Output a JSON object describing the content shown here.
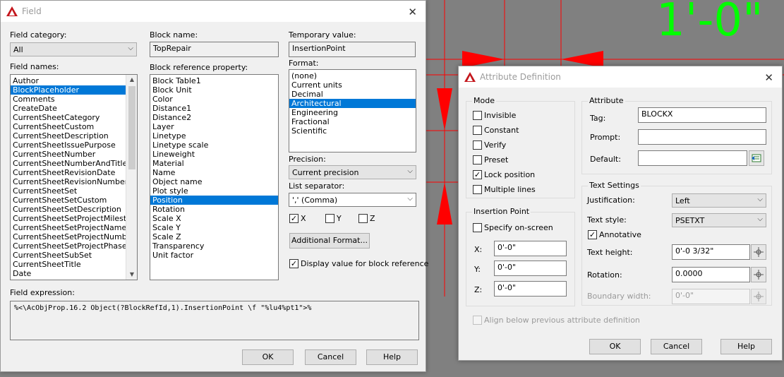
{
  "colors": {
    "dimension_line": "#ff0000",
    "dimension_text": "#00ff00",
    "selection": "#0078d7",
    "canvas": "#808080"
  },
  "canvas": {
    "dimension_text": "1'-0\""
  },
  "field_dialog": {
    "title": "Field",
    "field_category_label": "Field category:",
    "field_category_value": "All",
    "field_names_label": "Field names:",
    "field_names": [
      "Author",
      "BlockPlaceholder",
      "Comments",
      "CreateDate",
      "CurrentSheetCategory",
      "CurrentSheetCustom",
      "CurrentSheetDescription",
      "CurrentSheetIssuePurpose",
      "CurrentSheetNumber",
      "CurrentSheetNumberAndTitle",
      "CurrentSheetRevisionDate",
      "CurrentSheetRevisionNumber",
      "CurrentSheetSet",
      "CurrentSheetSetCustom",
      "CurrentSheetSetDescription",
      "CurrentSheetSetProjectMilestone",
      "CurrentSheetSetProjectName",
      "CurrentSheetSetProjectNumber",
      "CurrentSheetSetProjectPhase",
      "CurrentSheetSubSet",
      "CurrentSheetTitle",
      "Date"
    ],
    "field_names_selected": "BlockPlaceholder",
    "block_name_label": "Block name:",
    "block_name_value": "TopRepair",
    "block_ref_label": "Block reference property:",
    "block_ref_properties": [
      "Block Table1",
      "Block Unit",
      "Color",
      "Distance1",
      "Distance2",
      "Layer",
      "Linetype",
      "Linetype scale",
      "Lineweight",
      "Material",
      "Name",
      "Object name",
      "Plot style",
      "Position",
      "Rotation",
      "Scale X",
      "Scale Y",
      "Scale Z",
      "Transparency",
      "Unit factor"
    ],
    "block_ref_selected": "Position",
    "temp_value_label": "Temporary value:",
    "temp_value": "InsertionPoint",
    "format_label": "Format:",
    "formats": [
      "(none)",
      "Current units",
      "Decimal",
      "Architectural",
      "Engineering",
      "Fractional",
      "Scientific"
    ],
    "format_selected": "Architectural",
    "precision_label": "Precision:",
    "precision_value": "Current precision",
    "list_sep_label": "List separator:",
    "list_sep_value": "',' (Comma)",
    "x_label": "X",
    "y_label": "Y",
    "z_label": "Z",
    "additional_format_label": "Additional Format...",
    "display_value_label": "Display value for block reference",
    "field_expression_label": "Field expression:",
    "field_expression": "%<\\AcObjProp.16.2 Object(?BlockRefId,1).InsertionPoint \\f \"%lu4%pt1\">%",
    "ok_label": "OK",
    "cancel_label": "Cancel",
    "help_label": "Help"
  },
  "attr_dialog": {
    "title": "Attribute Definition",
    "mode_label": "Mode",
    "modes": {
      "invisible": "Invisible",
      "constant": "Constant",
      "verify": "Verify",
      "preset": "Preset",
      "lock_position": "Lock position",
      "multiple_lines": "Multiple lines"
    },
    "attribute_label": "Attribute",
    "tag_label": "Tag:",
    "tag_value": "BLOCKX",
    "prompt_label": "Prompt:",
    "prompt_value": "",
    "default_label": "Default:",
    "default_value": "",
    "insertion_label": "Insertion Point",
    "specify_label": "Specify on-screen",
    "x_label": "X:",
    "x_value": "0'-0\"",
    "y_label": "Y:",
    "y_value": "0'-0\"",
    "z_label": "Z:",
    "z_value": "0'-0\"",
    "text_settings_label": "Text Settings",
    "justification_label": "Justification:",
    "justification_value": "Left",
    "text_style_label": "Text style:",
    "text_style_value": "PSETXT",
    "annotative_label": "Annotative",
    "text_height_label": "Text height:",
    "text_height_value": "0'-0 3/32\"",
    "rotation_label": "Rotation:",
    "rotation_value": "0.0000",
    "boundary_label": "Boundary width:",
    "boundary_value": "0'-0\"",
    "align_label": "Align below previous attribute definition",
    "ok_label": "OK",
    "cancel_label": "Cancel",
    "help_label": "Help"
  }
}
